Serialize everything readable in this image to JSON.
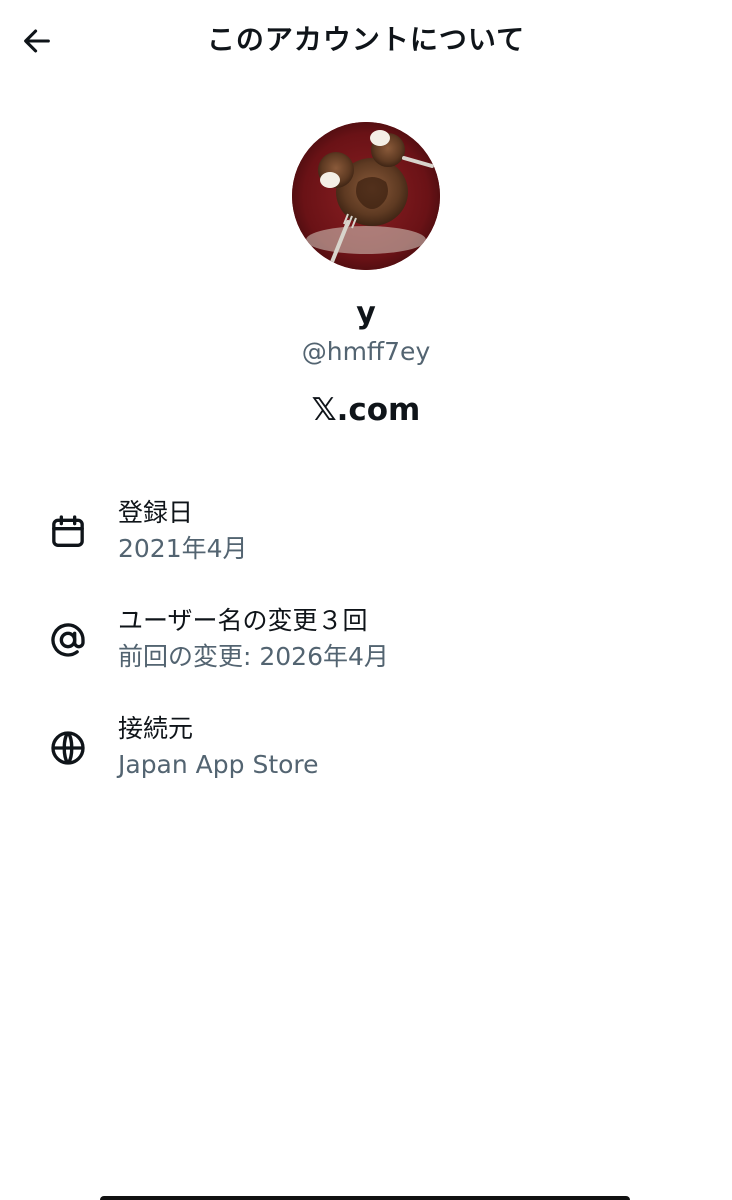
{
  "header": {
    "title": "このアカウントについて",
    "back_icon": "arrow-left-icon"
  },
  "profile": {
    "display_name": "y",
    "handle": "@hmff7ey",
    "site": "𝕏.com"
  },
  "info": {
    "joined": {
      "icon": "calendar-icon",
      "title": "登録日",
      "value": "2021年4月"
    },
    "username": {
      "icon": "at-sign-icon",
      "title": "ユーザー名の変更３回",
      "value": "前回の変更: 2026年4月"
    },
    "connected": {
      "icon": "globe-icon",
      "title": "接続元",
      "value": "Japan App Store"
    }
  },
  "colors": {
    "text_primary": "#0f1419",
    "text_secondary": "#536471",
    "background": "#ffffff"
  }
}
